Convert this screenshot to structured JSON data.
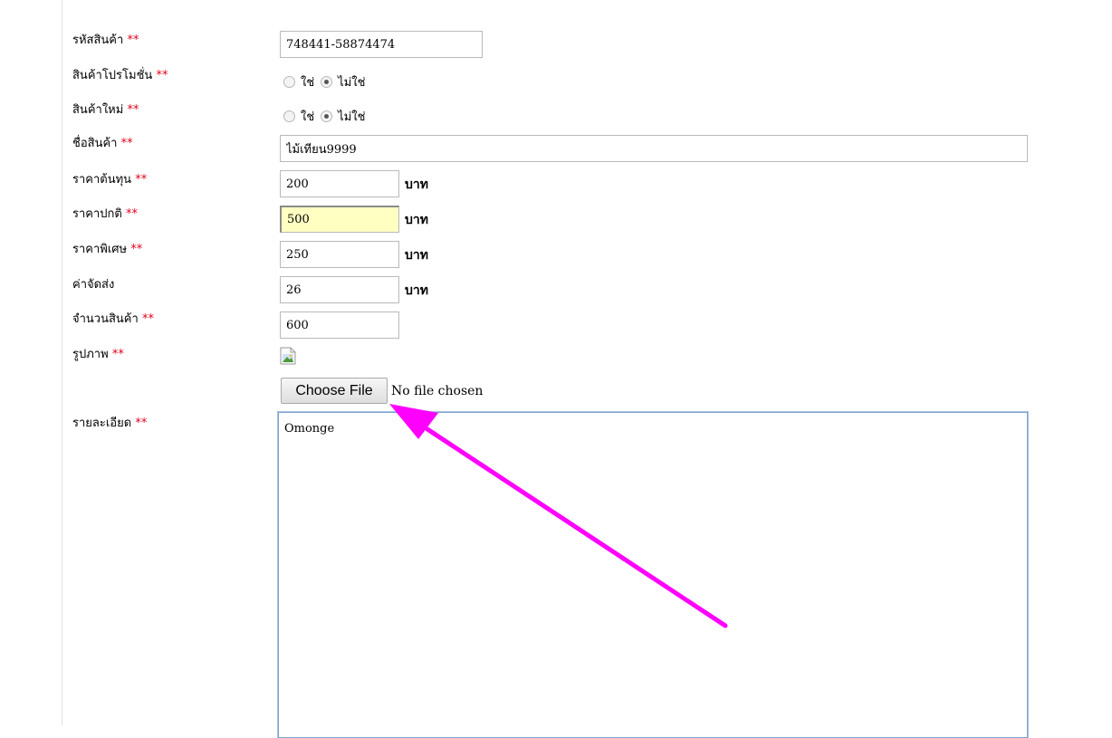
{
  "form": {
    "required_mark": "**",
    "product_code": {
      "label": "รหัสสินค้า",
      "value": "748441-58874474"
    },
    "promotion": {
      "label": "สินค้าโปรโมชั่น",
      "options": [
        "ใช่",
        "ไม่ใช่"
      ],
      "selected": "ไม่ใช่"
    },
    "new_product": {
      "label": "สินค้าใหม่",
      "options": [
        "ใช่",
        "ไม่ใช่"
      ],
      "selected": "ไม่ใช่"
    },
    "product_name": {
      "label": "ชื่อสินค้า",
      "value": "ไม้เทียน9999"
    },
    "cost_price": {
      "label": "ราคาต้นทุน",
      "value": "200",
      "unit": "บาท"
    },
    "normal_price": {
      "label": "ราคาปกติ",
      "value": "500",
      "unit": "บาท"
    },
    "special_price": {
      "label": "ราคาพิเศษ",
      "value": "250",
      "unit": "บาท"
    },
    "shipping": {
      "label": "ค่าจัดส่ง",
      "value": "26",
      "unit": "บาท"
    },
    "quantity": {
      "label": "จำนวนสินค้า",
      "value": "600"
    },
    "image": {
      "label": "รูปภาพ",
      "button": "Choose File",
      "status": "No file chosen",
      "icon": "broken-image-icon"
    },
    "details": {
      "label": "รายละเอียด",
      "value": "Omonge"
    }
  },
  "annotation": {
    "color": "#ff00ff",
    "icon": "pointer-arrow"
  }
}
